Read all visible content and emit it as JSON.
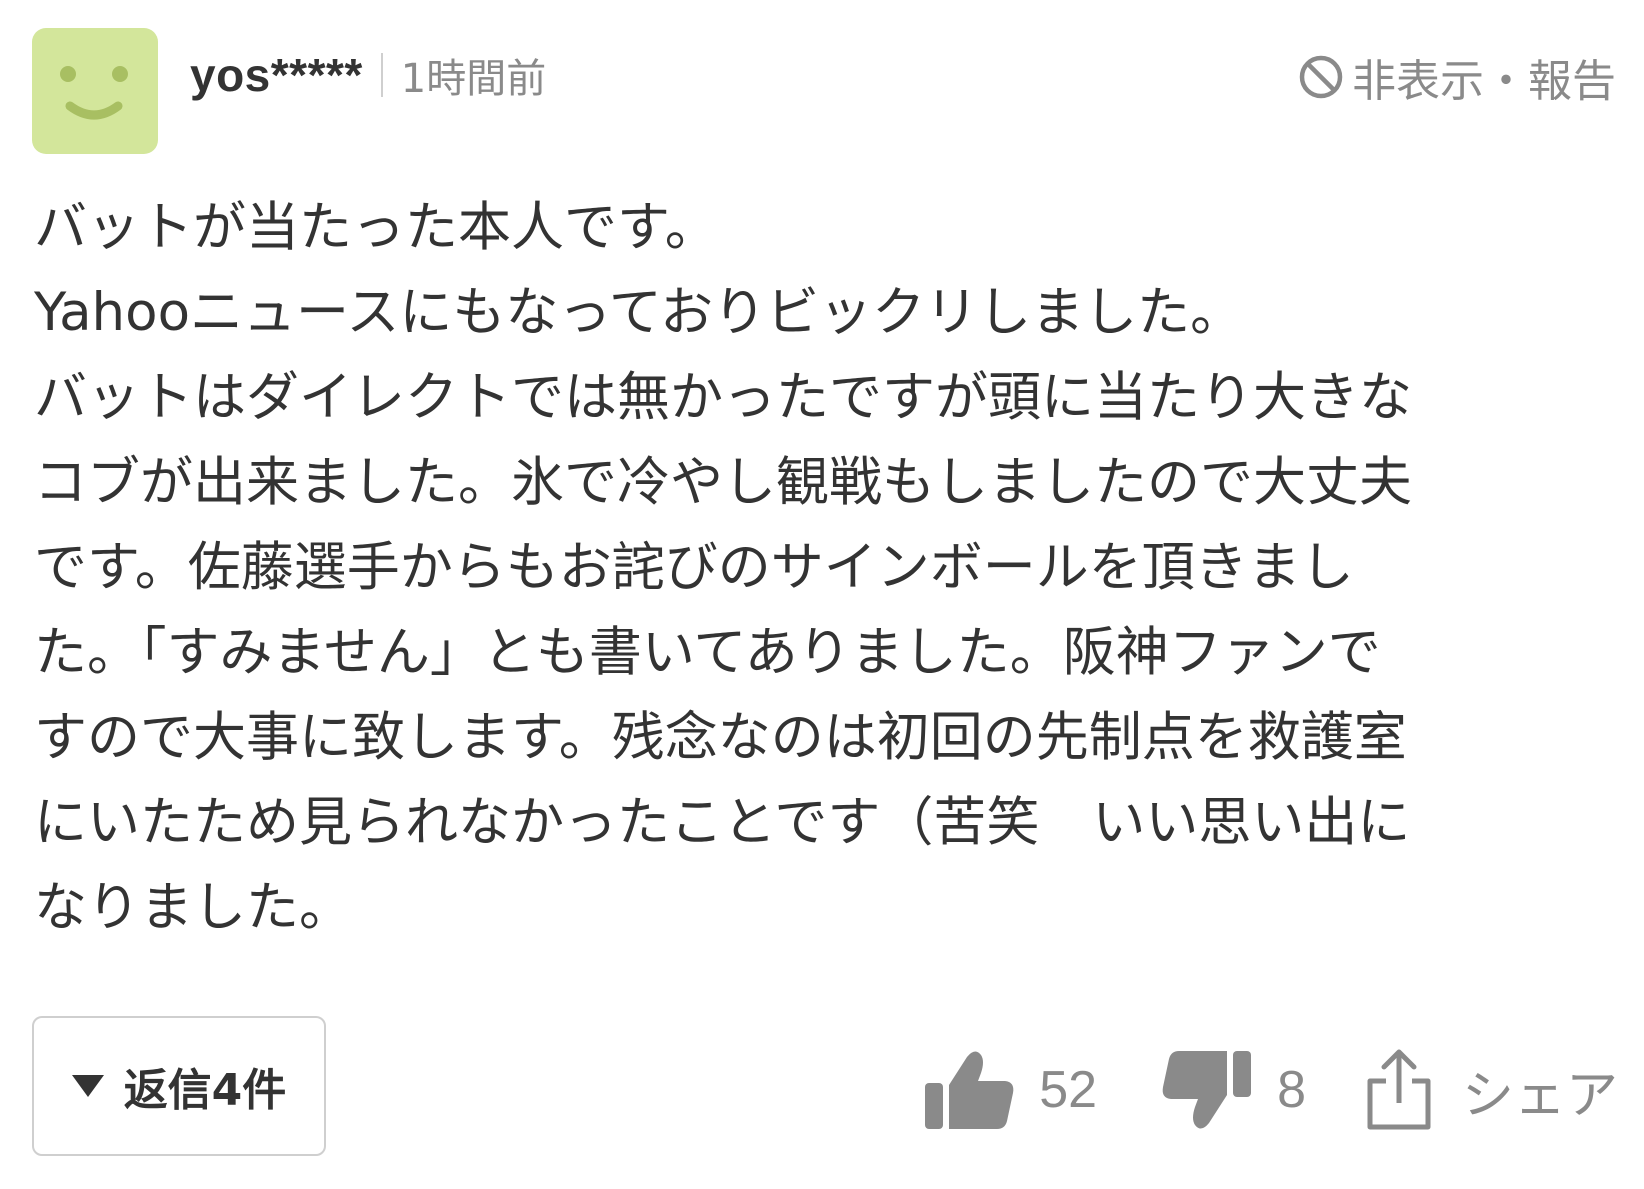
{
  "comment": {
    "avatar_icon": "smiley-face-icon",
    "avatar_color": "#d3e69b",
    "username": "yos*****",
    "timestamp": "1時間前",
    "hide_report_icon": "prohibited-icon",
    "hide_report_label": "非表示・報告",
    "body": "バットが当たった本人です。\nYahooニュースにもなっておりビックリしました。\nバットはダイレクトでは無かったですが頭に当たり大きな\nコブが出来ました。氷で冷やし観戦もしましたので大丈夫\nです。佐藤選手からもお詫びのサインボールを頂きまし\nた。「すみません」とも書いてありました。阪神ファンで\nすので大事に致します。残念なのは初回の先制点を救護室\nにいたため見られなかったことです（苦笑　いい思い出に\nなりました。",
    "replies_label": "返信4件",
    "like_icon": "thumbs-up-icon",
    "like_count": "52",
    "dislike_icon": "thumbs-down-icon",
    "dislike_count": "8",
    "share_icon": "share-icon",
    "share_label": "シェア"
  }
}
